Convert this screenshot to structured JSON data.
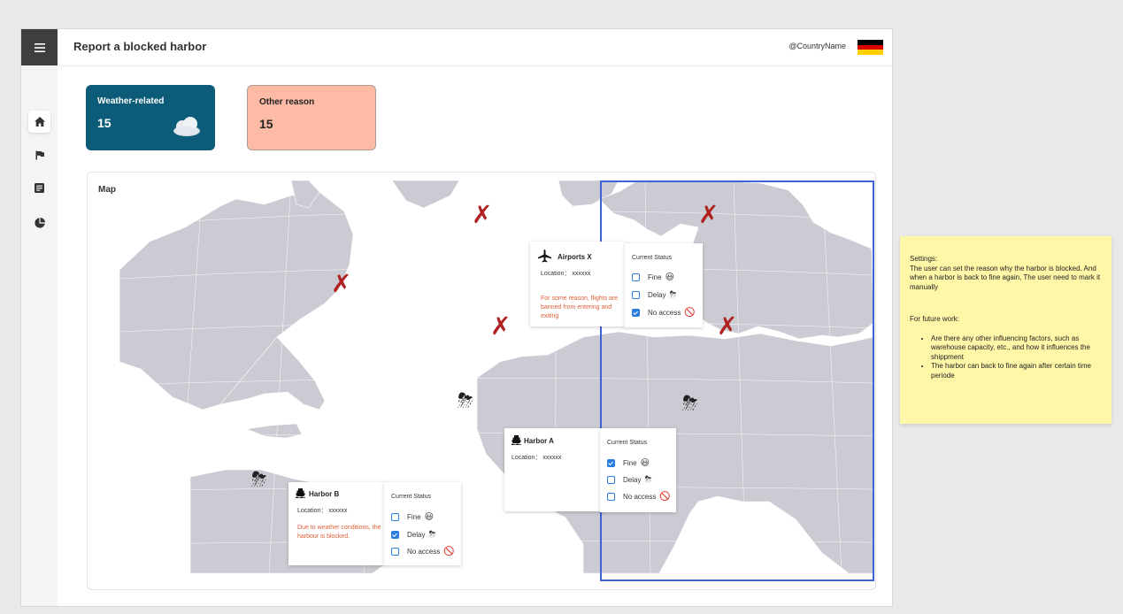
{
  "app": {
    "page_title": "Report a blocked harbor",
    "country": "@CountryName",
    "flag_colors": [
      "#000000",
      "#dd0000",
      "#ffce00"
    ]
  },
  "nav": {
    "items": [
      {
        "icon": "home-icon",
        "active": true
      },
      {
        "icon": "flag-icon",
        "active": false
      },
      {
        "icon": "document-icon",
        "active": false
      },
      {
        "icon": "pie-chart-icon",
        "active": false
      }
    ]
  },
  "cards": {
    "weather": {
      "label": "Weather-related",
      "count": "15",
      "color": "#0c5c79"
    },
    "other": {
      "label": "Other reason",
      "count": "15",
      "color": "#fdbba5"
    }
  },
  "map": {
    "title": "Map",
    "airport": {
      "name": "Airports X",
      "location": "Location： xxxxxx",
      "note": "For some reason, flights are banned from entering and exiting"
    },
    "harbor_a": {
      "name": "Harbor A",
      "location": "Location： xxxxxx"
    },
    "harbor_b": {
      "name": "Harbor B",
      "location": "Location： xxxxxx",
      "note": "Due to weather conditions, the harbour is blocked."
    },
    "status": {
      "title": "Current Status",
      "fine": "Fine",
      "delay": "Delay",
      "no_access": "No access"
    },
    "airport_status": {
      "fine": false,
      "delay": false,
      "no_access": true
    },
    "harbor_a_status": {
      "fine": true,
      "delay": false,
      "no_access": false
    },
    "harbor_b_status": {
      "fine": false,
      "delay": true,
      "no_access": false
    },
    "highlight_color": "#3d63d6"
  },
  "note": {
    "settings_title": "Settings:",
    "settings_text": "The user can set the reason why the harbor is blocked. And when a harbor is back to fine again, The user need to mark it manually",
    "future_title": "For future work:",
    "future_items": [
      "Are there any other influencing factors, such as warehouse capacity, etc., and how it influences the shippment",
      "The harbor can back to fine again after certain time periode"
    ]
  }
}
